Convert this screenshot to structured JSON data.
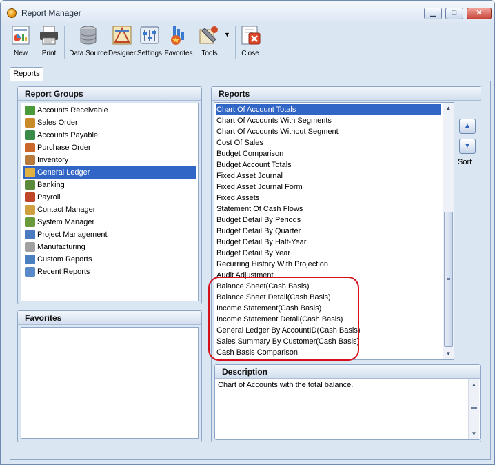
{
  "window": {
    "title": "Report Manager",
    "minimize_glyph": "▁",
    "maximize_glyph": "□",
    "close_glyph": "✕"
  },
  "toolbar": {
    "new": "New",
    "print": "Print",
    "data_source": "Data Source",
    "designer": "Designer",
    "settings": "Settings",
    "favorites": "Favorites",
    "tools": "Tools",
    "close": "Close"
  },
  "tabs": {
    "reports": "Reports"
  },
  "report_groups": {
    "title": "Report Groups",
    "selected": "General Ledger",
    "items": [
      {
        "label": "Accounts Receivable",
        "icon": "accounts-receivable-icon",
        "color": "#4a9a3a"
      },
      {
        "label": "Sales Order",
        "icon": "sales-order-icon",
        "color": "#c98a2a"
      },
      {
        "label": "Accounts Payable",
        "icon": "accounts-payable-icon",
        "color": "#3a8a4a"
      },
      {
        "label": "Purchase Order",
        "icon": "purchase-order-icon",
        "color": "#c9682a"
      },
      {
        "label": "Inventory",
        "icon": "inventory-icon",
        "color": "#b87a3a"
      },
      {
        "label": "General Ledger",
        "icon": "general-ledger-icon",
        "color": "#e0b040"
      },
      {
        "label": "Banking",
        "icon": "banking-icon",
        "color": "#5a8a3a"
      },
      {
        "label": "Payroll",
        "icon": "payroll-icon",
        "color": "#c0462a"
      },
      {
        "label": "Contact Manager",
        "icon": "contact-manager-icon",
        "color": "#d0a040"
      },
      {
        "label": "System Manager",
        "icon": "system-manager-icon",
        "color": "#6a9a3a"
      },
      {
        "label": "Project Management",
        "icon": "project-management-icon",
        "color": "#4a7ac0"
      },
      {
        "label": "Manufacturing",
        "icon": "manufacturing-icon",
        "color": "#a0a0a0"
      },
      {
        "label": "Custom Reports",
        "icon": "custom-reports-icon",
        "color": "#4a80c0"
      },
      {
        "label": "Recent Reports",
        "icon": "recent-reports-icon",
        "color": "#5a8ac8"
      }
    ]
  },
  "favorites": {
    "title": "Favorites"
  },
  "reports": {
    "title": "Reports",
    "selected": "Chart Of Account Totals",
    "items": [
      "Chart Of Account Totals",
      "Chart Of Accounts With Segments",
      "Chart Of Accounts Without Segment",
      "Cost Of Sales",
      "Budget Comparison",
      "Budget Account Totals",
      "Fixed Asset Journal",
      "Fixed Asset Journal Form",
      "Fixed Assets",
      "Statement Of Cash Flows",
      "Budget Detail By Periods",
      "Budget Detail By Quarter",
      "Budget Detail By Half-Year",
      "Budget Detail By Year",
      "Recurring History With Projection",
      "Audit Adjustment",
      "Balance Sheet(Cash Basis)",
      "Balance Sheet Detail(Cash Basis)",
      "Income Statement(Cash Basis)",
      "Income Statement Detail(Cash Basis)",
      "General Ledger By AccountID(Cash Basis)",
      "Sales Summary By Customer(Cash Basis)",
      "Cash Basis Comparison"
    ]
  },
  "sort": {
    "label": "Sort",
    "up_glyph": "▲",
    "down_glyph": "▼"
  },
  "description": {
    "title": "Description",
    "text": "Chart of Accounts with the total balance."
  },
  "colors": {
    "selection": "#3165c6",
    "highlight_ring": "#d4101a",
    "background": "#dbe6f3"
  }
}
